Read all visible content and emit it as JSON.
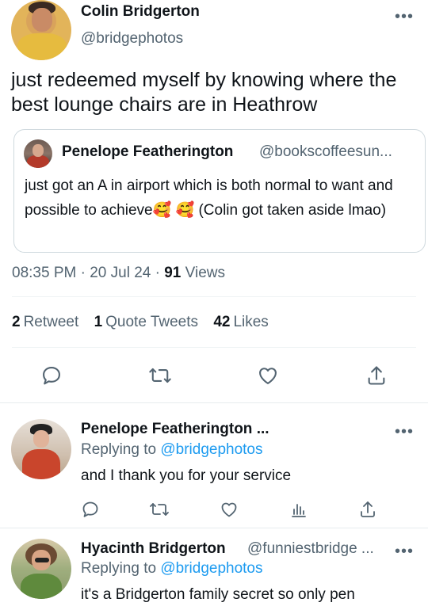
{
  "main_tweet": {
    "author_name": "Colin Bridgerton",
    "author_handle": "@bridgephotos",
    "more": "•••",
    "text": "just redeemed myself by knowing where the best lounge chairs are in Heathrow",
    "quoted": {
      "author_name": "Penelope Featherington",
      "author_handle": "@bookscoffeesun...",
      "text": "just got an A in airport which is both normal to want and possible to achieve🥰 🥰  (Colin got taken aside lmao)"
    },
    "time": "08:35 PM",
    "date": "20 Jul 24",
    "separator": "·",
    "views_count": "91",
    "views_label": "Views",
    "stats": {
      "retweet_count": "2",
      "retweet_label": "Retweet",
      "quote_count": "1",
      "quote_label": "Quote Tweets",
      "likes_count": "42",
      "likes_label": "Likes"
    },
    "actions": [
      "reply-icon",
      "retweet-icon",
      "like-icon",
      "share-icon"
    ]
  },
  "replies": [
    {
      "author_name": "Penelope Featherington ...",
      "replying_label": "Replying to",
      "replying_handle": "@bridgephotos",
      "text": "and I thank you for your service",
      "more": "•••",
      "actions": [
        "reply-icon",
        "retweet-icon",
        "like-icon",
        "analytics-icon",
        "share-icon"
      ]
    },
    {
      "author_name": "Hyacinth Bridgerton",
      "author_handle": "@funniestbridge ...",
      "replying_label": "Replying to",
      "replying_handle": "@bridgephotos",
      "text": "it's a Bridgerton family secret so only pen",
      "more": "•••"
    }
  ],
  "colors": {
    "primary_text": "#0f1419",
    "secondary_text": "#536471",
    "accent": "#1d9bf0",
    "border": "#cfd9de"
  }
}
